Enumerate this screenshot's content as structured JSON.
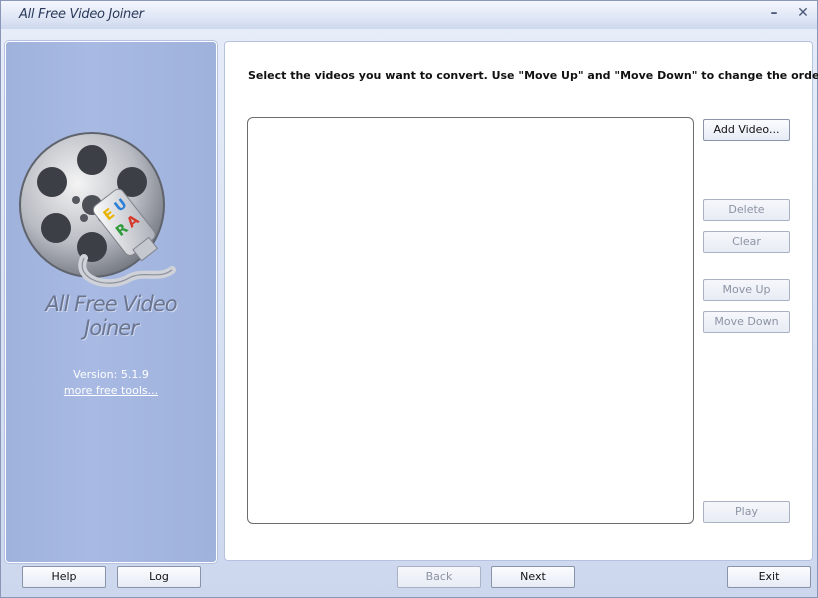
{
  "window": {
    "title": "All Free Video Joiner",
    "minimize_glyph": "–",
    "close_glyph": "✕"
  },
  "left_panel": {
    "logo_icon": "film-reel-tube-icon",
    "app_name_line1": "All Free Video",
    "app_name_line2": "Joiner",
    "version": "Version: 5.1.9",
    "more_tools": "more free tools..."
  },
  "main": {
    "instruction": "Select the videos you want to convert. Use \"Move Up\" and \"Move Down\" to change the order.",
    "buttons": {
      "add_video": "Add Video...",
      "delete": "Delete",
      "clear": "Clear",
      "move_up": "Move Up",
      "move_down": "Move Down",
      "play": "Play"
    }
  },
  "bottom": {
    "help": "Help",
    "log": "Log",
    "back": "Back",
    "next": "Next",
    "exit": "Exit"
  },
  "colors": {
    "left_panel_bg": "#a4b6e0",
    "window_bg": "#dfe6f5",
    "logo_tube_letters": [
      "#e8b400",
      "#2b7fd6",
      "#2f9a3a",
      "#d63a2b"
    ]
  }
}
